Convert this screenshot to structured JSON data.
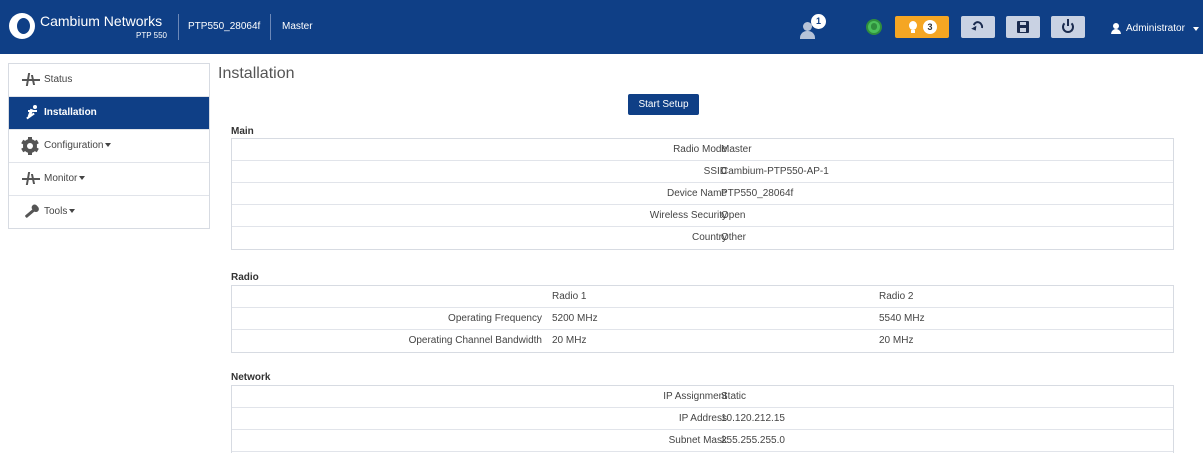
{
  "header": {
    "brand": "Cambium Networks",
    "model": "PTP 550",
    "device_name": "PTP550_28064f",
    "role": "Master",
    "users_badge": "1",
    "alerts_count": "3",
    "user_label": "Administrator",
    "alert_color": "#f5a623",
    "bar_color": "#0f3f86"
  },
  "sidebar": {
    "items": [
      {
        "label": "Status",
        "icon": "pulse-icon",
        "active": false
      },
      {
        "label": "Installation",
        "icon": "runner-icon",
        "active": true
      },
      {
        "label": "Configuration",
        "icon": "gear-icon",
        "active": false
      },
      {
        "label": "Monitor",
        "icon": "pulse-icon",
        "active": false
      },
      {
        "label": "Tools",
        "icon": "wrench-icon",
        "active": false
      }
    ]
  },
  "main": {
    "title": "Installation",
    "start_setup": "Start Setup",
    "sections": {
      "main": {
        "title": "Main",
        "rows": [
          {
            "key": "Radio Mode",
            "value": "Master"
          },
          {
            "key": "SSID",
            "value": "Cambium-PTP550-AP-1"
          },
          {
            "key": "Device Name",
            "value": "PTP550_28064f"
          },
          {
            "key": "Wireless Security",
            "value": "Open"
          },
          {
            "key": "Country",
            "value": "Other"
          }
        ]
      },
      "radio": {
        "title": "Radio",
        "headers": [
          "Radio 1",
          "Radio 2"
        ],
        "rows": [
          {
            "key": "Operating Frequency",
            "r1": "5200 MHz",
            "r2": "5540 MHz"
          },
          {
            "key": "Operating Channel Bandwidth",
            "r1": "20 MHz",
            "r2": "20 MHz"
          }
        ]
      },
      "network": {
        "title": "Network",
        "rows": [
          {
            "key": "IP Assignment",
            "value": "Static"
          },
          {
            "key": "IP Address",
            "value": "10.120.212.15"
          },
          {
            "key": "Subnet Mask",
            "value": "255.255.255.0"
          }
        ]
      }
    }
  }
}
